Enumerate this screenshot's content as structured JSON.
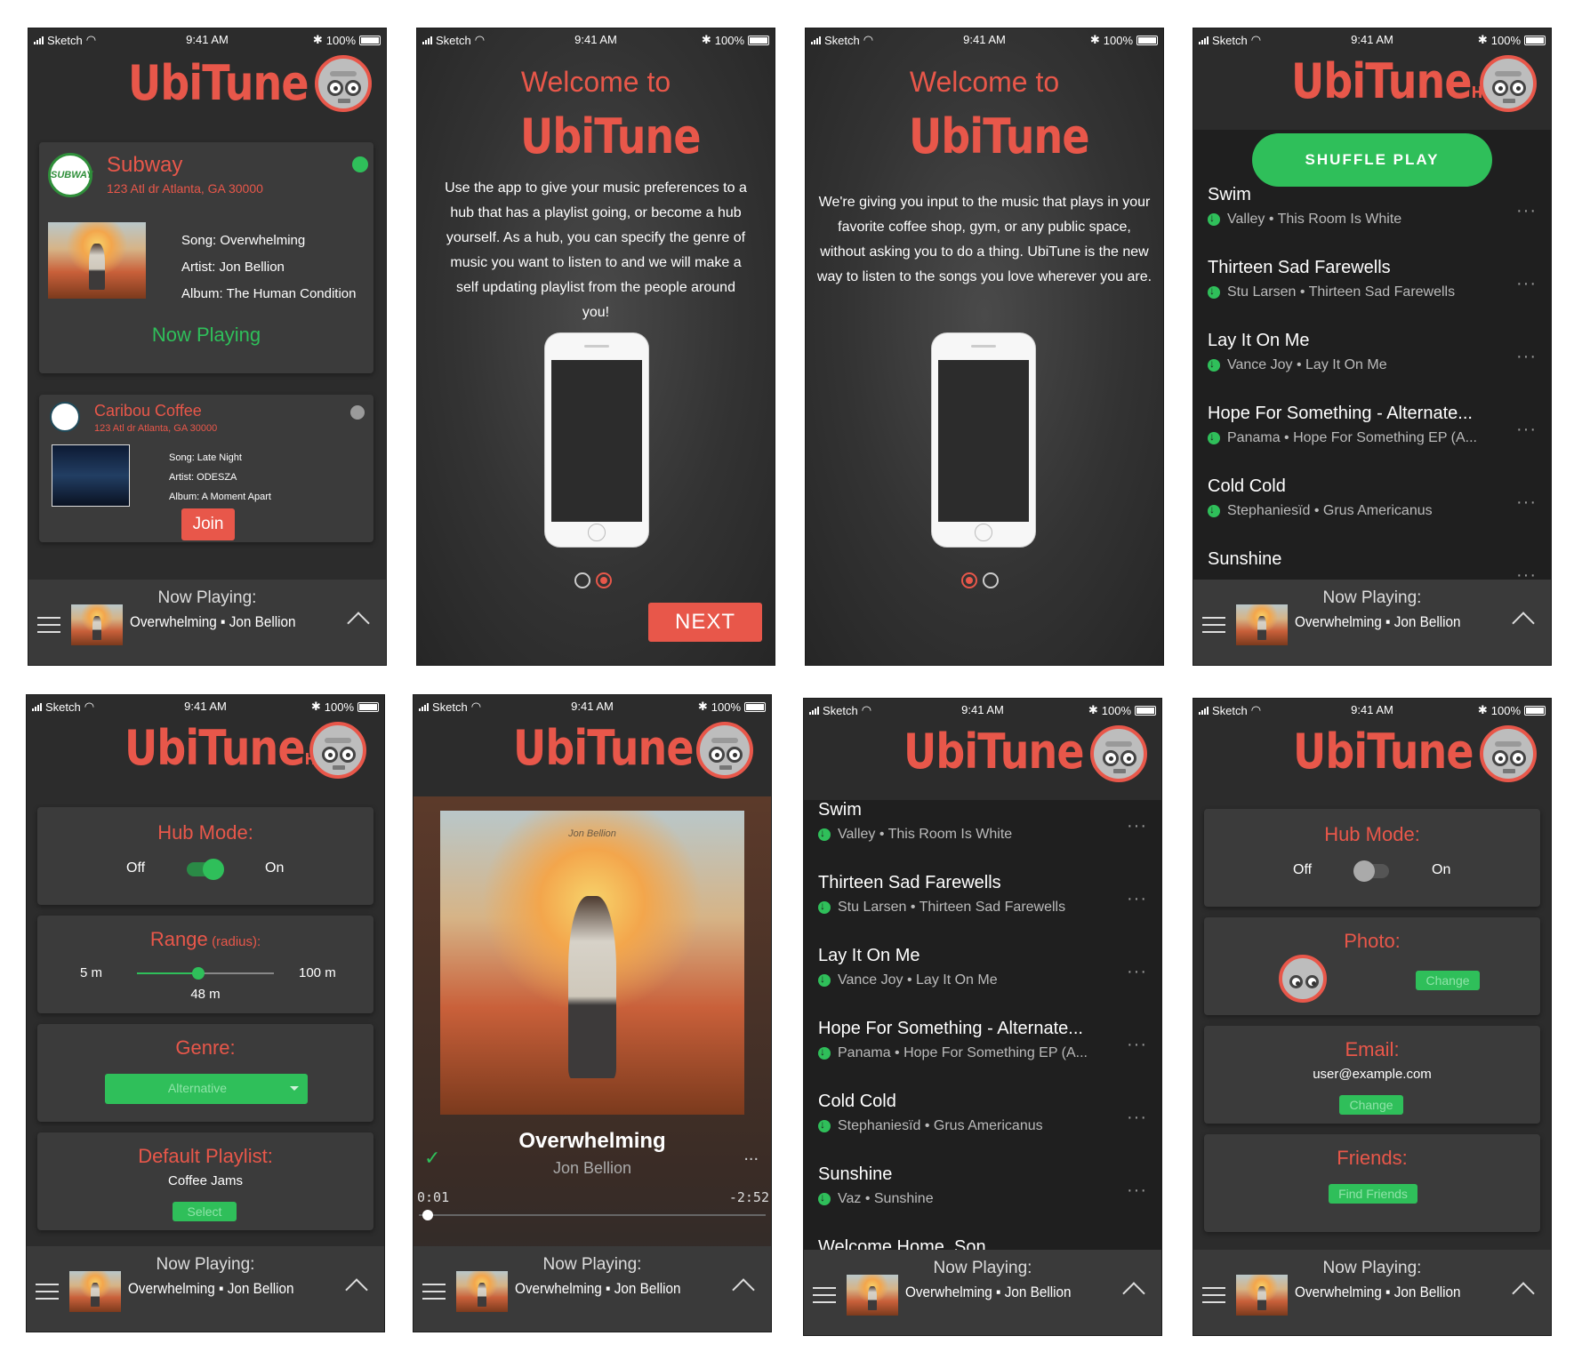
{
  "status": {
    "carrier": "Sketch",
    "time": "9:41 AM",
    "battery": "100%"
  },
  "brand": {
    "name": "UbiTune",
    "hub_sub": "Hub"
  },
  "bottom": {
    "label": "Now Playing:",
    "track": "Overwhelming ▪ Jon Bellion"
  },
  "s1": {
    "venue1": {
      "name": "Subway",
      "address": "123 Atl dr Atlanta, GA 30000",
      "song": "Song: Overwhelming",
      "artist": "Artist: Jon Bellion",
      "album": "Album: The Human Condition",
      "status": "Now Playing"
    },
    "venue2": {
      "name": "Caribou Coffee",
      "address": "123 Atl dr Atlanta, GA 30000",
      "song": "Song: Late Night",
      "artist": "Artist: ODESZA",
      "album": "Album: A Moment Apart",
      "join": "Join"
    }
  },
  "s2": {
    "welcome": "Welcome to",
    "body": "Use the app to give your music preferences to a hub that has a playlist going, or become a hub yourself. As a hub, you can specify the genre of music you want to listen to and we will make a self updating playlist from the people around you!",
    "next": "NEXT"
  },
  "s3": {
    "welcome": "Welcome to",
    "body": "We're giving you input to the music that plays in your favorite coffee shop, gym, or any public space, without asking you to do a thing. UbiTune is the new way to  listen to the songs you love wherever you are."
  },
  "s4": {
    "shuffle": "SHUFFLE PLAY",
    "tracks": [
      {
        "title": "Swim",
        "sub": "Valley • This Room Is White"
      },
      {
        "title": "Thirteen Sad Farewells",
        "sub": "Stu Larsen • Thirteen Sad Farewells"
      },
      {
        "title": "Lay It On Me",
        "sub": "Vance Joy • Lay It On Me"
      },
      {
        "title": "Hope For Something - Alternate...",
        "sub": "Panama • Hope For Something EP (A..."
      },
      {
        "title": "Cold Cold",
        "sub": "Stephaniesïd • Grus Americanus"
      },
      {
        "title": "Sunshine",
        "sub": ""
      }
    ]
  },
  "s5": {
    "hub_mode": "Hub Mode:",
    "off": "Off",
    "on": "On",
    "range_title": "Range",
    "range_sub": "(radius):",
    "range_min": "5 m",
    "range_max": "100 m",
    "range_value": "48 m",
    "range_fraction": 0.45,
    "genre_title": "Genre:",
    "genre_value": "Alternative",
    "playlist_title": "Default Playlist:",
    "playlist_value": "Coffee Jams",
    "select": "Select"
  },
  "s6": {
    "song": "Overwhelming",
    "artist": "Jon Bellion",
    "elapsed": "0:01",
    "remaining": "-2:52",
    "more": "...",
    "art_text": "Jon Bellion",
    "progress": 0.01
  },
  "s7": {
    "tracks": [
      {
        "title": "Swim",
        "sub": "Valley • This Room Is White"
      },
      {
        "title": "Thirteen Sad Farewells",
        "sub": "Stu Larsen • Thirteen Sad Farewells"
      },
      {
        "title": "Lay It On Me",
        "sub": "Vance Joy • Lay It On Me"
      },
      {
        "title": "Hope For Something - Alternate...",
        "sub": "Panama • Hope For Something EP (A..."
      },
      {
        "title": "Cold Cold",
        "sub": "Stephaniesïd • Grus Americanus"
      },
      {
        "title": "Sunshine",
        "sub": "Vaz • Sunshine"
      },
      {
        "title": "Welcome Home, Son",
        "sub": ""
      }
    ]
  },
  "s8": {
    "hub_mode": "Hub Mode:",
    "off": "Off",
    "on": "On",
    "photo_title": "Photo:",
    "change": "Change",
    "email_title": "Email:",
    "email_value": "user@example.com",
    "friends_title": "Friends:",
    "find_friends": "Find Friends"
  },
  "colors": {
    "accent": "#e8574a",
    "green": "#2fbf5a",
    "bg": "#2c2c2c"
  }
}
